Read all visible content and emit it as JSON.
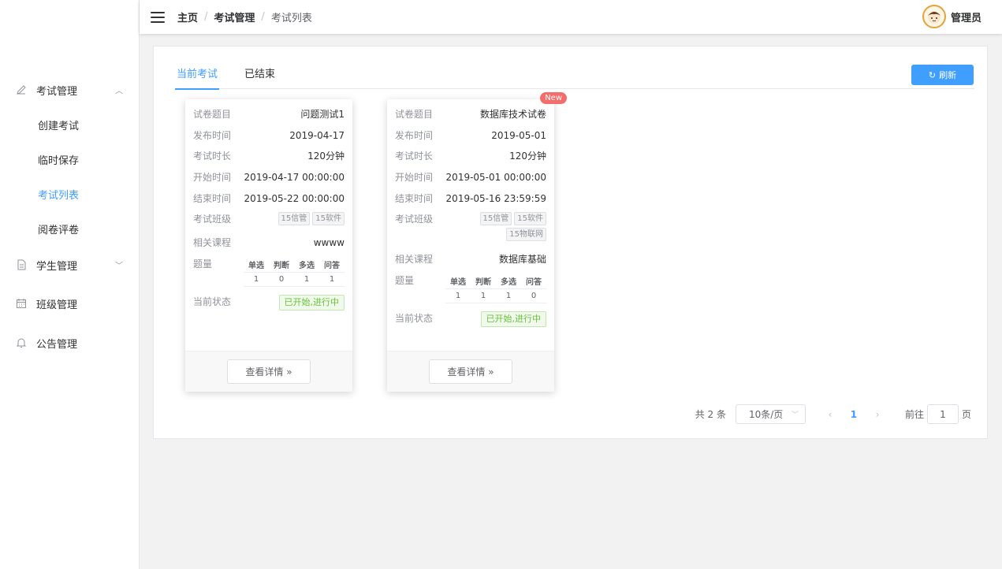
{
  "header": {
    "breadcrumb": [
      "主页",
      "考试管理",
      "考试列表"
    ],
    "user_name": "管理员"
  },
  "sidebar": {
    "groups": [
      {
        "label": "考试管理",
        "icon": "pencil-icon",
        "expanded": true,
        "items": [
          {
            "label": "创建考试",
            "active": false
          },
          {
            "label": "临时保存",
            "active": false
          },
          {
            "label": "考试列表",
            "active": true
          },
          {
            "label": "阅卷评卷",
            "active": false
          }
        ]
      },
      {
        "label": "学生管理",
        "icon": "document-icon",
        "expanded": false
      },
      {
        "label": "班级管理",
        "icon": "calendar-icon"
      },
      {
        "label": "公告管理",
        "icon": "bell-icon"
      }
    ]
  },
  "tabs": [
    {
      "label": "当前考试",
      "active": true
    },
    {
      "label": "已结束",
      "active": false
    }
  ],
  "refresh_label": "刷新",
  "labels": {
    "paper_title": "试卷题目",
    "publish_time": "发布时间",
    "duration": "考试时长",
    "start_time": "开始时间",
    "end_time": "结束时间",
    "classes": "考试班级",
    "course": "相关课程",
    "question_count": "题量",
    "status": "当前状态",
    "q_headers": [
      "单选",
      "判断",
      "多选",
      "问答"
    ],
    "detail_button": "查看详情 »"
  },
  "exams": [
    {
      "title": "问题测试1",
      "publish_date": "2019-04-17",
      "duration": "120分钟",
      "start": "2019-04-17 00:00:00",
      "end": "2019-05-22 00:00:00",
      "classes": [
        "15信管",
        "15软件"
      ],
      "course": "wwww",
      "questions": [
        "1",
        "0",
        "1",
        "1"
      ],
      "status": "已开始,进行中",
      "is_new": false
    },
    {
      "title": "数据库技术试卷",
      "publish_date": "2019-05-01",
      "duration": "120分钟",
      "start": "2019-05-01 00:00:00",
      "end": "2019-05-16 23:59:59",
      "classes": [
        "15信管",
        "15软件",
        "15物联网"
      ],
      "course": "数据库基础",
      "questions": [
        "1",
        "1",
        "1",
        "0"
      ],
      "status": "已开始,进行中",
      "is_new": true,
      "badge": "New"
    }
  ],
  "pagination": {
    "total_text": "共 2 条",
    "page_size": "10条/页",
    "current_page": "1",
    "goto_prefix": "前往",
    "goto_value": "1",
    "goto_suffix": "页"
  },
  "colors": {
    "primary": "#409eff",
    "success": "#67c23a",
    "danger": "#f56c6c"
  }
}
